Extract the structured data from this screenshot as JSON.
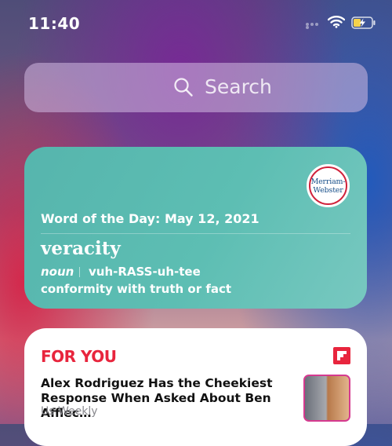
{
  "status_bar": {
    "time": "11:40"
  },
  "search": {
    "placeholder": "Search"
  },
  "word_of_day": {
    "logo_line1": "Merriam-",
    "logo_line2": "Webster",
    "date_label": "Word of the Day: May 12, 2021",
    "word": "veracity",
    "part_of_speech": "noun",
    "pronunciation": "vuh-RASS-uh-tee",
    "definition": "conformity with truth or fact"
  },
  "news": {
    "header": "FOR YOU",
    "headline": "Alex Rodriguez Has the Cheekiest Response When Asked About Ben Afflec…",
    "source": "Us Weekly"
  }
}
